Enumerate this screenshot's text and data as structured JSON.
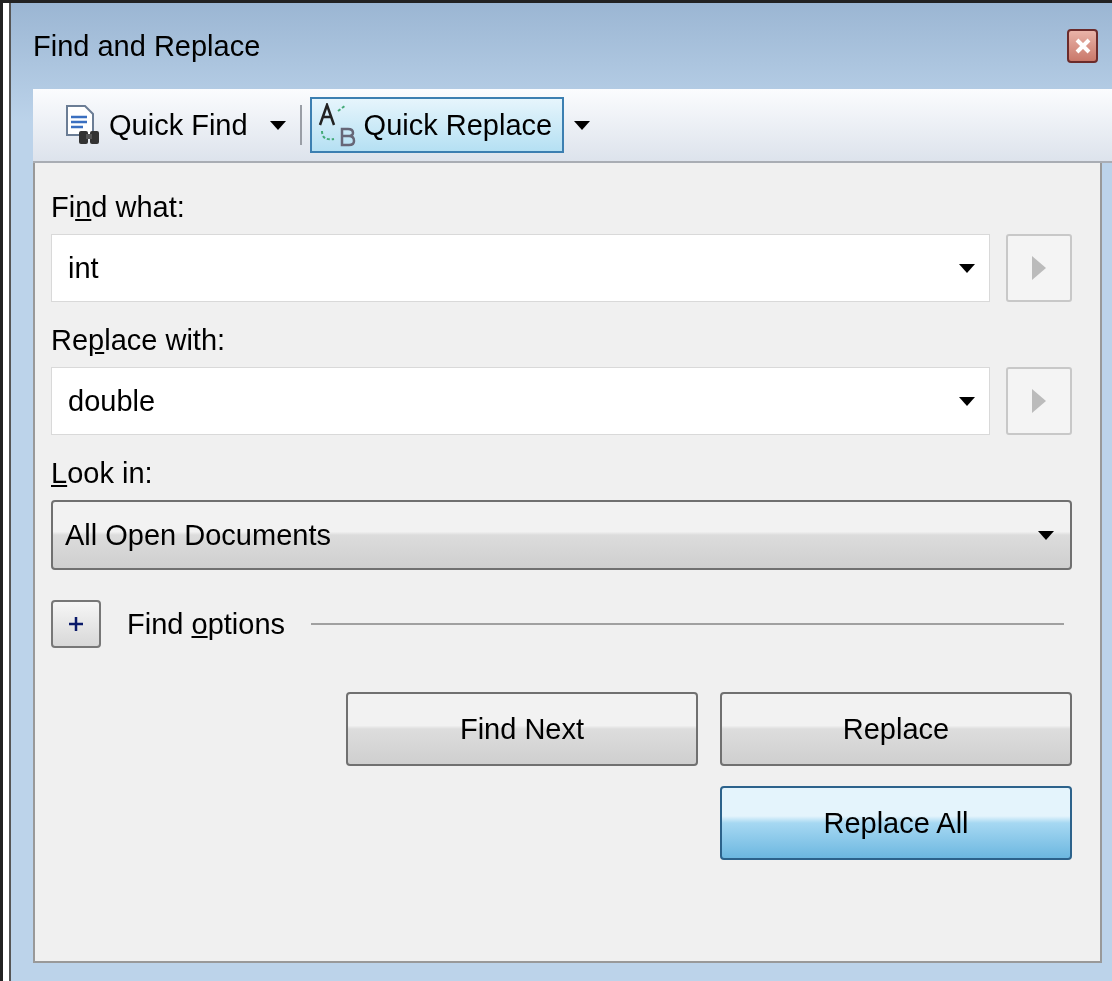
{
  "window": {
    "title": "Find and Replace"
  },
  "toolbar": [
    {
      "label": "Quick Find",
      "selected": false
    },
    {
      "label": "Quick Replace",
      "selected": true
    }
  ],
  "fields": [
    {
      "label": {
        "before": "Fi",
        "key": "n",
        "after": "d what:"
      },
      "value": "int"
    },
    {
      "label": {
        "before": "Re",
        "key": "p",
        "after": "lace with:"
      },
      "value": "double"
    }
  ],
  "look_in": {
    "label": {
      "key": "L",
      "after": "ook in:"
    },
    "value": "All Open Documents"
  },
  "find_options": {
    "label": {
      "before": "Find ",
      "key": "o",
      "after": "ptions"
    },
    "expanded": false
  },
  "buttons": [
    {
      "label": "Find Next",
      "default": false
    },
    {
      "label": "Replace",
      "default": false
    },
    {
      "label": "Replace All",
      "default": true
    }
  ]
}
